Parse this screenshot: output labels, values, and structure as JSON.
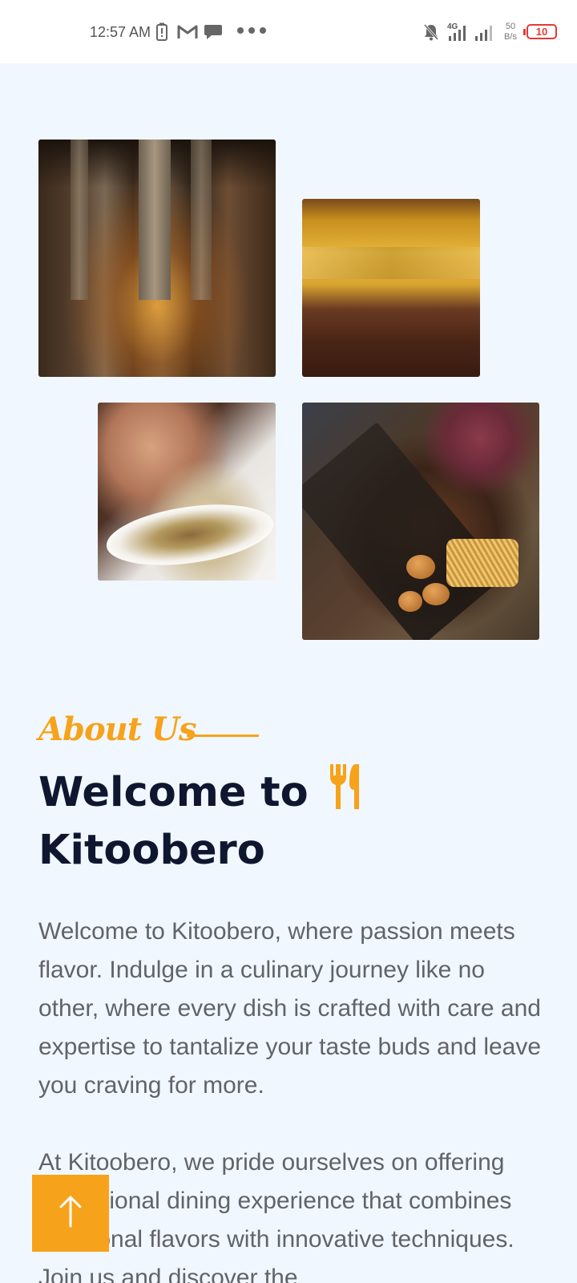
{
  "status_bar": {
    "time": "12:57 AM",
    "network_type": "4G",
    "net_speed_value": "50",
    "net_speed_unit": "B/s",
    "battery_level": "10",
    "icons": [
      "battery-saver-icon",
      "gmail-icon",
      "chat-bubble-icon",
      "more-dots-icon",
      "mute-bell-icon",
      "signal-4g-icon",
      "signal-bars-icon"
    ]
  },
  "gallery": {
    "images": [
      {
        "name": "restaurant-interior-dark"
      },
      {
        "name": "restaurant-interior-yellow"
      },
      {
        "name": "salad-dish"
      },
      {
        "name": "grill-platter"
      }
    ]
  },
  "about": {
    "tag": "About Us",
    "heading_line1": "Welcome to",
    "heading_line2": "Kitoobero",
    "icon": "cutlery-icon",
    "paragraph1": "Welcome to Kitoobero, where passion meets flavor. Indulge in a culinary journey like no other, where every dish is crafted with care and expertise to tantalize your taste buds and leave you craving for more.",
    "paragraph2": "At Kitoobero, we pride ourselves on offering exceptional dining experience that combines traditional flavors with innovative techniques. Join us and discover the"
  },
  "colors": {
    "accent": "#f7a21b",
    "heading": "#0f1730",
    "body_text": "#606469",
    "background": "#f1f7fe"
  },
  "scroll_top": {
    "icon": "arrow-up-icon"
  }
}
